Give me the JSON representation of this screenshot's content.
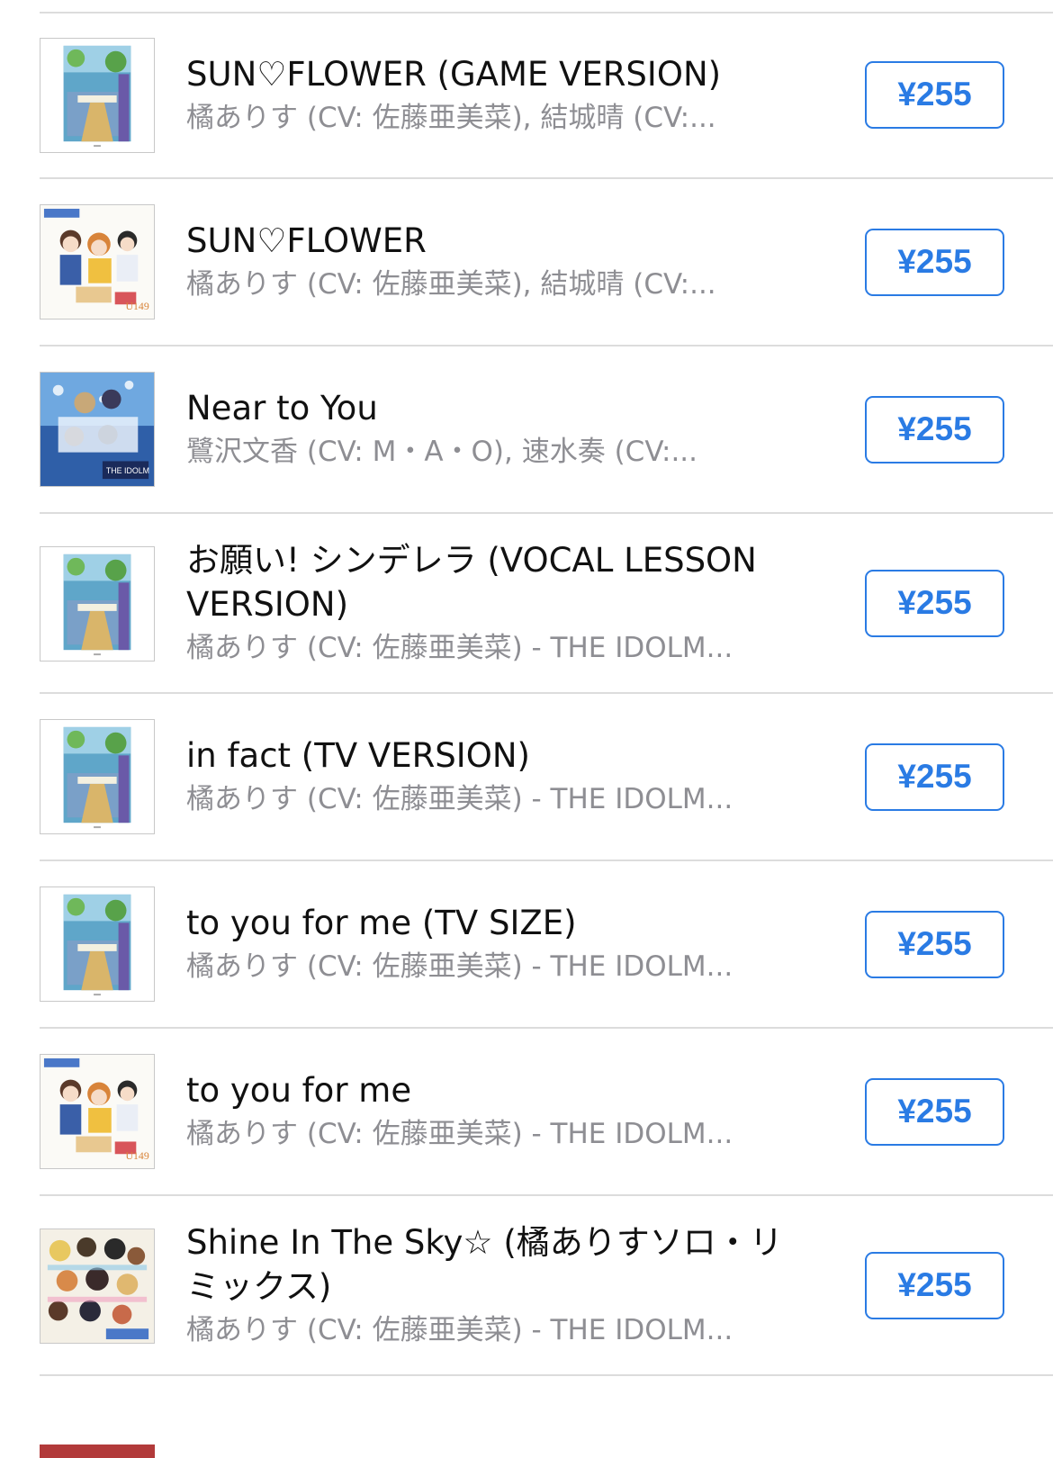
{
  "songs": [
    {
      "title": "SUN♡FLOWER (GAME VERSION)",
      "subtitle": "橘ありす (CV: 佐藤亜美菜), 結城晴 (CV:...",
      "price": "¥255",
      "art": "soundtrack"
    },
    {
      "title": "SUN♡FLOWER",
      "subtitle": "橘ありす (CV: 佐藤亜美菜), 結城晴 (CV:...",
      "price": "¥255",
      "art": "u149"
    },
    {
      "title": "Near to You",
      "subtitle": "鷺沢文香 (CV: M・A・O), 速水奏 (CV:...",
      "price": "¥255",
      "art": "blue-group"
    },
    {
      "title": "お願い! シンデレラ (VOCAL LESSON VERSION)",
      "subtitle": "橘ありす (CV: 佐藤亜美菜) - THE IDOLM...",
      "price": "¥255",
      "art": "soundtrack"
    },
    {
      "title": "in fact (TV VERSION)",
      "subtitle": "橘ありす (CV: 佐藤亜美菜) - THE IDOLM...",
      "price": "¥255",
      "art": "soundtrack"
    },
    {
      "title": "to you for me (TV SIZE)",
      "subtitle": "橘ありす (CV: 佐藤亜美菜) - THE IDOLM...",
      "price": "¥255",
      "art": "soundtrack"
    },
    {
      "title": "to you for me",
      "subtitle": "橘ありす (CV: 佐藤亜美菜) - THE IDOLM...",
      "price": "¥255",
      "art": "u149"
    },
    {
      "title": "Shine In The Sky☆ (橘ありすソロ・リミックス)",
      "subtitle": "橘ありす (CV: 佐藤亜美菜) - THE IDOLM...",
      "price": "¥255",
      "art": "crowd"
    }
  ],
  "colors": {
    "accent": "#2a7be4",
    "subtitle": "#8e8e93",
    "separator": "#dcdcdc"
  }
}
